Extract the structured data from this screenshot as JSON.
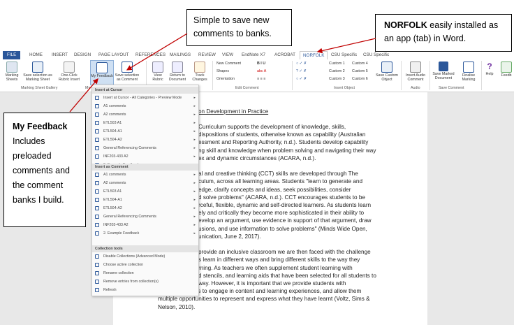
{
  "tabs": [
    "FILE",
    "HOME",
    "INSERT",
    "DESIGN",
    "PAGE LAYOUT",
    "REFERENCES",
    "MAILINGS",
    "REVIEW",
    "VIEW",
    "EndNote X7",
    "ACROBAT",
    "NORFOLK",
    "CSU Specific",
    "CSU Specific"
  ],
  "ribbon": {
    "btn_marking_sheets": "Marking Sheets",
    "btn_save_selection_marking": "Save selection as Marking Sheet",
    "btn_one_click": "One-Click Rubric Insert",
    "btn_my_feedback": "My Feedback",
    "btn_save_comment": "Save selection as Comment",
    "btn_view_rubric": "View Rubric",
    "btn_return_doc": "Return to Document",
    "btn_track": "Track Changes",
    "new_comment": "New Comment",
    "shapes": "Shapes",
    "orientation": "Orientation",
    "custom1": "Custom 1",
    "custom2": "Custom 2",
    "custom3": "Custom 3",
    "custom4": "Custom 4",
    "custom5": "Custom 5",
    "custom6": "Custom 6",
    "btn_save_custom": "Save Custom Object",
    "btn_insert_audio": "Insert Audio Comment",
    "btn_save_marked": "Save Marked Document",
    "btn_finalise": "Finalise Marking",
    "btn_help": "Help",
    "btn_feedback": "Feedb",
    "grp_marking_sheet": "Marking Sheet Gallery",
    "grp_my": "My",
    "grp_edit_comment": "Edit Comment",
    "grp_insert_object": "Insert Object",
    "grp_audio": "Audio",
    "grp_save": "Save Comment"
  },
  "menu": {
    "head_insert_cursor": "Insert at Cursor",
    "cursor_items": [
      "Insert at Cursor - All Categories - Preview Mode",
      "A1 comments",
      "A2 comments",
      "ETL503 A1",
      "ETL504-A1",
      "ETL504-A2",
      "General Referencing Comments",
      "INF203-433 A2",
      "2. Example Feedback"
    ],
    "head_insert_comment": "Insert as Comment",
    "comment_items": [
      "A1 comments",
      "A2 comments",
      "ETL503 A1",
      "ETL504-A1",
      "ETL504-A2",
      "General Referencing Comments",
      "INF203-433 A2",
      "2. Example Feedback"
    ],
    "head_tools": "Collection tools",
    "tool_items": [
      "Disable Collections (Advanced Mode)",
      "Choose active collection",
      "Rename collection",
      "Remove entries from collection(s)",
      "Refresh"
    ]
  },
  "document": {
    "heading": "on Development in Practice",
    "lines": [
      "Curriculum supports the development of knowledge, skills,",
      "dispositions of students, otherwise known as capability (Australian",
      "essment and Reporting Authority, n.d.). Students develop capability",
      "ng skill and knowledge when problem solving and navigating their way",
      "ex and dynamic circumstances (ACARA, n.d.).",
      "",
      "al and creative thinking (CCT) skills are developed through The",
      "culum, across all learning areas. Students \"learn to generate and",
      "edge, clarify concepts and ideas, seek possibilities, consider",
      "d solve problems\" (ACARA, n.d.). CCT encourages students to be",
      "rceful, flexible, dynamic and self-directed learners. As students learn",
      "ely and critically they become more sophisticated in their ability to",
      "evelop an argument, use evidence in support of that argument, draw",
      "usions, and use information to solve problems\" (Minds Wide Open,",
      "unication, June 2, 2017).",
      "",
      "provide an inclusive classroom we are then faced with the challenge",
      "s learn in different ways and bring different skills to the way they",
      "rning. As teachers we often supplement student learning with",
      "d stencils, and learning aids that have been selected for all students to",
      "way. However, it is important that we provide students with",
      "multiple avenues to engage in content and learning experiences, and allow them",
      "multiple opportunities to represent and express what they have learnt (Voltz, Sims &",
      "Nelson, 2010)."
    ]
  },
  "callouts": {
    "simple_save": "Simple to save new comments to banks.",
    "norfolk_bold": "NORFOLK",
    "norfolk_rest": " easily installed as an app (tab) in Word.",
    "myfeedback_bold": "My Feedback",
    "myfeedback_rest": "Includes preloaded comments and the comment banks I build."
  },
  "colors": {
    "accent": "#2b579a",
    "arrow": "#c00000"
  }
}
